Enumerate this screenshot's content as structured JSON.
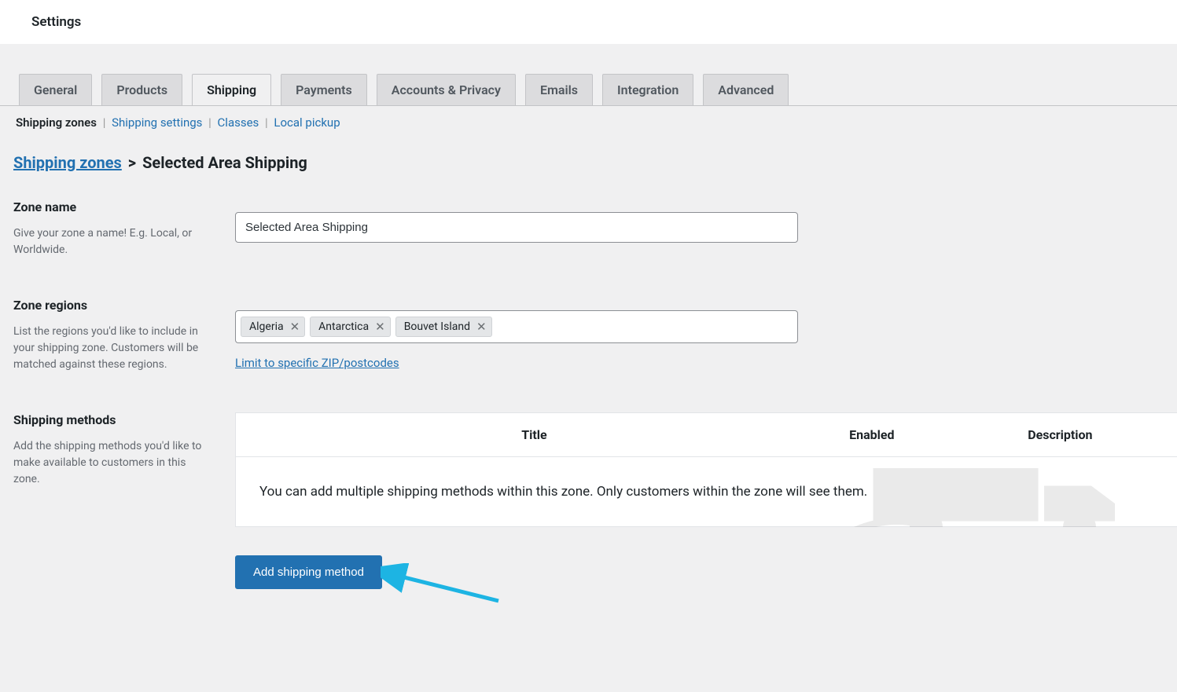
{
  "header": {
    "title": "Settings"
  },
  "tabs": [
    {
      "label": "General"
    },
    {
      "label": "Products"
    },
    {
      "label": "Shipping",
      "active": true
    },
    {
      "label": "Payments"
    },
    {
      "label": "Accounts & Privacy"
    },
    {
      "label": "Emails"
    },
    {
      "label": "Integration"
    },
    {
      "label": "Advanced"
    }
  ],
  "subtabs": [
    {
      "label": "Shipping zones",
      "active": true
    },
    {
      "label": "Shipping settings"
    },
    {
      "label": "Classes"
    },
    {
      "label": "Local pickup"
    }
  ],
  "breadcrumb": {
    "link": "Shipping zones",
    "sep": ">",
    "current": "Selected Area Shipping"
  },
  "zone_name": {
    "label": "Zone name",
    "help": "Give your zone a name! E.g. Local, or Worldwide.",
    "value": "Selected Area Shipping"
  },
  "zone_regions": {
    "label": "Zone regions",
    "help": "List the regions you'd like to include in your shipping zone. Customers will be matched against these regions.",
    "tags": [
      "Algeria",
      "Antarctica",
      "Bouvet Island"
    ],
    "limit_link": "Limit to specific ZIP/postcodes"
  },
  "shipping_methods": {
    "label": "Shipping methods",
    "help": "Add the shipping methods you'd like to make available to customers in this zone.",
    "cols": {
      "title": "Title",
      "enabled": "Enabled",
      "description": "Description"
    },
    "empty_text": "You can add multiple shipping methods within this zone. Only customers within the zone will see them.",
    "add_button": "Add shipping method"
  }
}
